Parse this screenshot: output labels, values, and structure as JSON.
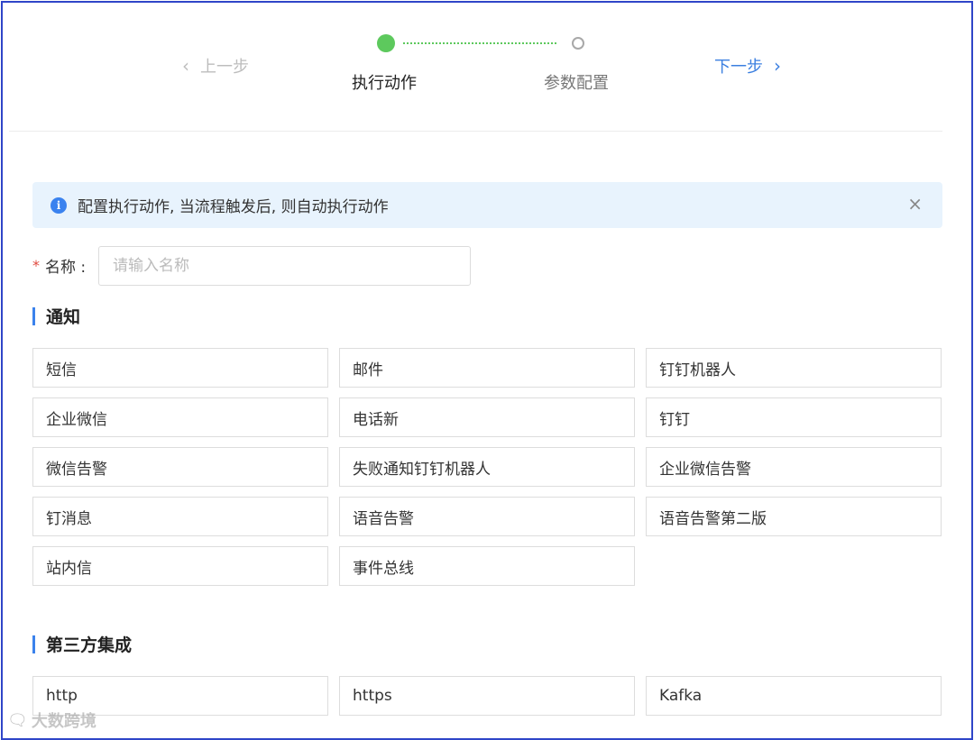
{
  "stepper": {
    "prev_label": "上一步",
    "next_label": "下一步",
    "steps": [
      "执行动作",
      "参数配置"
    ],
    "current_step": 1
  },
  "alert": {
    "text": "配置执行动作, 当流程触发后, 则自动执行动作",
    "close_glyph": "×"
  },
  "form": {
    "name_label": "名称 :",
    "name_placeholder": "请输入名称",
    "name_value": ""
  },
  "sections": [
    {
      "title": "通知",
      "items": [
        "短信",
        "邮件",
        "钉钉机器人",
        "企业微信",
        "电话新",
        "钉钉",
        "微信告警",
        "失败通知钉钉机器人",
        "企业微信告警",
        "钉消息",
        "语音告警",
        "语音告警第二版",
        "站内信",
        "事件总线"
      ]
    },
    {
      "title": "第三方集成",
      "items": [
        "http",
        "https",
        "Kafka"
      ]
    }
  ],
  "watermark": {
    "text": "大数跨境"
  },
  "colors": {
    "accent": "#3b7fe0",
    "success": "#5dc95d",
    "alert_bg": "#e8f3fd",
    "frame": "#2f45c8"
  }
}
